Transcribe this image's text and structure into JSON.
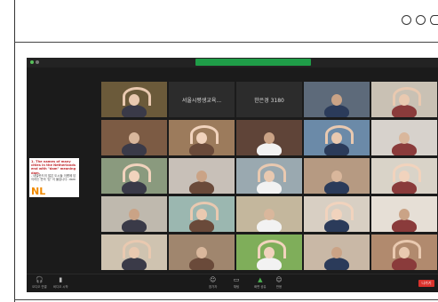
{
  "window": {
    "title": "",
    "controls": [
      "minimize-circle",
      "maximize-circle",
      "close-circle"
    ]
  },
  "zoom": {
    "meeting_label": "",
    "recording_text": "",
    "view_label": "",
    "share": {
      "line1": "1. The names of many cities in the Netherlands end with \"dam\" meaning dam.",
      "line2": "- 네덜란드의 많은 도시들 이름에 담이라는 뜻의 '담' 이 붙습니다. dam",
      "logo": "NL"
    },
    "text_tiles": [
      "서울시평생교육...",
      "한은경 3180"
    ],
    "toolbar": {
      "items": [
        {
          "icon": "mic",
          "label": "오디오 연결"
        },
        {
          "icon": "video",
          "label": "비디오 시작"
        },
        {
          "icon": "people",
          "label": "참가자"
        },
        {
          "icon": "chat",
          "label": "채팅"
        },
        {
          "icon": "share",
          "label": "화면 공유"
        },
        {
          "icon": "record",
          "label": "반응"
        }
      ],
      "end_label": "나가기"
    },
    "colors": {
      "background": "#1b1b1b",
      "recording_bar": "#1f9d48",
      "end_button": "#d9322c",
      "logo_orange": "#f08a00"
    }
  }
}
